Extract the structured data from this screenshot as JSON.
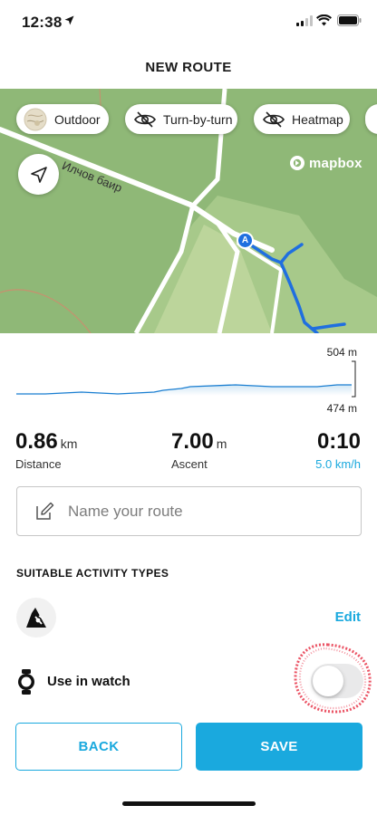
{
  "status_bar": {
    "time": "12:38"
  },
  "header": {
    "title": "NEW ROUTE"
  },
  "map": {
    "chips": [
      {
        "label": "Outdoor",
        "icon": "outdoor-map-thumbnail-icon"
      },
      {
        "label": "Turn-by-turn",
        "icon": "eye-off-icon"
      },
      {
        "label": "Heatmap",
        "icon": "eye-off-icon"
      }
    ],
    "road_label": "Илчов баир",
    "brand": "mapbox",
    "start_marker": "A"
  },
  "elevation": {
    "max": "504 m",
    "min": "474 m"
  },
  "stats": {
    "distance": {
      "value": "0.86",
      "unit": "km",
      "label": "Distance"
    },
    "ascent": {
      "value": "7.00",
      "unit": "m",
      "label": "Ascent"
    },
    "duration": {
      "value": "0:10",
      "speed": "5.0 km/h"
    }
  },
  "name_field": {
    "placeholder": "Name your route",
    "value": ""
  },
  "activities": {
    "title": "SUITABLE ACTIVITY TYPES",
    "edit_label": "Edit"
  },
  "watch": {
    "label": "Use in watch",
    "enabled": false
  },
  "footer": {
    "back_label": "BACK",
    "save_label": "SAVE"
  },
  "colors": {
    "accent": "#1aa9de",
    "map_green": "#8fb877",
    "route_blue": "#1f6fe0",
    "annotation_red": "#e8364a"
  }
}
